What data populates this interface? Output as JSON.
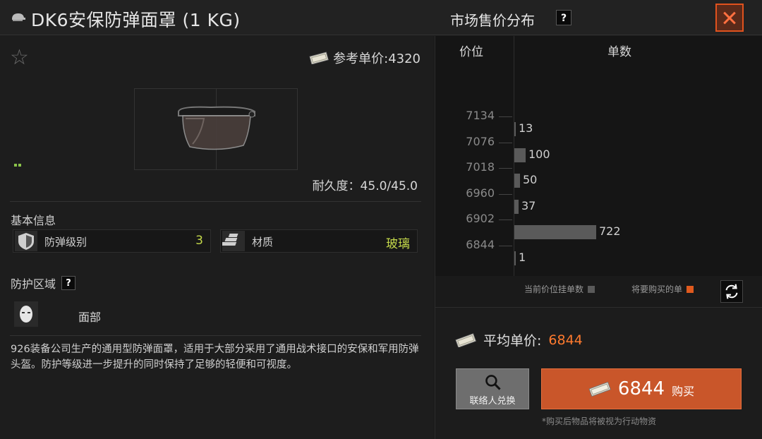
{
  "item": {
    "title": "DK6安保防弹面罩 (1 KG)",
    "ref_price_label": "参考单价:4320",
    "durability": "耐久度：45.0/45.0"
  },
  "market": {
    "title": "市场售价分布",
    "help": "?",
    "col_price": "价位",
    "col_qty": "单数"
  },
  "basic_info": {
    "label": "基本信息",
    "stats": [
      {
        "name": "防弹级别",
        "value": "3",
        "icon": "shield-icon"
      },
      {
        "name": "材质",
        "value": "玻璃",
        "icon": "material-icon"
      }
    ]
  },
  "protection": {
    "label": "防护区域",
    "help": "?",
    "zone": "面部"
  },
  "description": "926装备公司生产的通用型防弹面罩，适用于大部分采用了通用战术接口的安保和军用防弹头盔。防护等级进一步提升的同时保持了足够的轻便和可视度。",
  "chart_data": {
    "type": "bar",
    "orientation": "horizontal",
    "categories": [
      "7134",
      "7076",
      "7018",
      "6960",
      "6902",
      "6844"
    ],
    "values": [
      13,
      100,
      50,
      37,
      722,
      1
    ],
    "xlabel": "单数",
    "ylabel": "价位",
    "colors": {
      "bar": "#5a5a5a",
      "highlight": "#e05a1e"
    }
  },
  "legend": {
    "current": "当前价位挂单数",
    "to_buy": "将要购买的单"
  },
  "purchase": {
    "avg_label": "平均单价:",
    "avg_value": "6844",
    "contact_label": "联络人兑换",
    "buy_price": "6844",
    "buy_label": "购买",
    "note": "*购买后物品将被视为行动物资"
  },
  "colors": {
    "accent": "#c9562a",
    "price_highlight": "#ff7a2e",
    "stat_value": "#c4d94a"
  }
}
